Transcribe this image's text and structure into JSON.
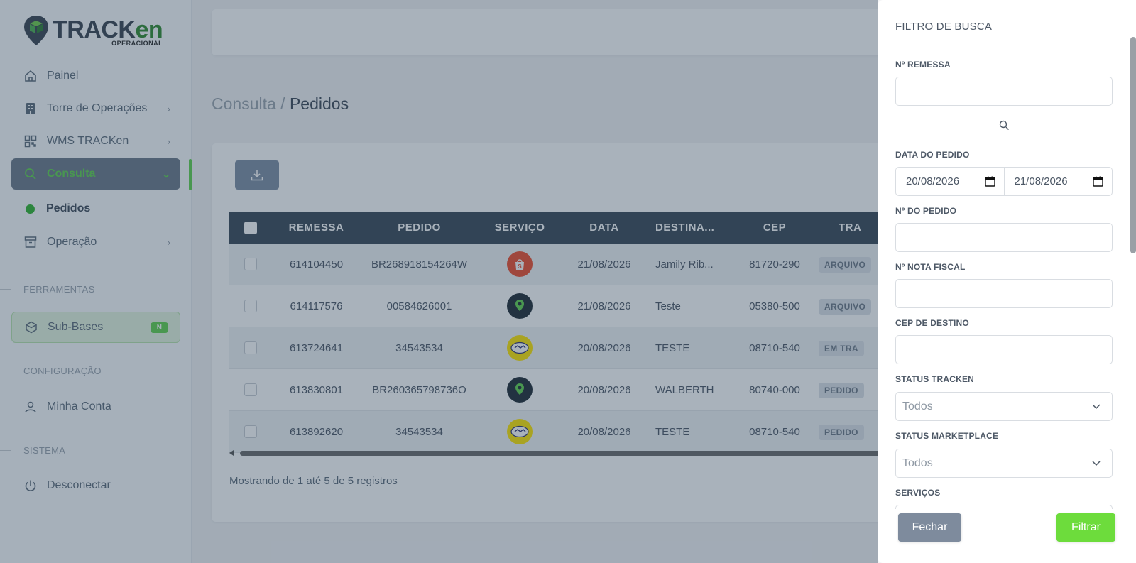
{
  "app": {
    "logo_main": "TRACK",
    "logo_accent": "en",
    "logo_sub": "OPERACIONAL"
  },
  "sidebar": {
    "items": [
      {
        "label": "Painel",
        "icon": "home-icon"
      },
      {
        "label": "Torre de Operações",
        "icon": "building-icon"
      },
      {
        "label": "WMS TRACKen",
        "icon": "qr-icon"
      },
      {
        "label": "Consulta",
        "icon": "search-icon"
      },
      {
        "label": "Pedidos"
      },
      {
        "label": "Operação",
        "icon": "archive-icon"
      }
    ],
    "section_tools": "FERRAMENTAS",
    "subbases": {
      "label": "Sub-Bases",
      "badge": "N"
    },
    "section_config": "CONFIGURAÇÃO",
    "account": "Minha Conta",
    "section_system": "SISTEMA",
    "logout": "Desconectar"
  },
  "breadcrumb": {
    "parent": "Consulta /",
    "current": "Pedidos"
  },
  "table": {
    "headers": [
      "REMESSA",
      "PEDIDO",
      "SERVIÇO",
      "DATA",
      "DESTINA...",
      "CEP",
      "TRA"
    ],
    "rows": [
      {
        "remessa": "614104450",
        "pedido": "BR268918154264W",
        "servico": "shopee",
        "data": "21/08/2026",
        "destino": "Jamily Rib...",
        "cep": "81720-290",
        "status": "ARQUIVO"
      },
      {
        "remessa": "614117576",
        "pedido": "00584626001",
        "servico": "tracken",
        "data": "21/08/2026",
        "destino": "Teste",
        "cep": "05380-500",
        "status": "ARQUIVO"
      },
      {
        "remessa": "613724641",
        "pedido": "34543534",
        "servico": "mercadolivre",
        "data": "20/08/2026",
        "destino": "TESTE",
        "cep": "08710-540",
        "status": "EM TRA"
      },
      {
        "remessa": "613830801",
        "pedido": "BR260365798736O",
        "servico": "tracken",
        "data": "20/08/2026",
        "destino": "WALBERTH",
        "cep": "80740-000",
        "status": "PEDIDO"
      },
      {
        "remessa": "613892620",
        "pedido": "34543534",
        "servico": "mercadolivre",
        "data": "20/08/2026",
        "destino": "TESTE",
        "cep": "08710-540",
        "status": "PEDIDO"
      }
    ],
    "footer": "Mostrando de 1 até 5 de 5 registros"
  },
  "filter": {
    "title": "FILTRO DE BUSCA",
    "remessa_label": "Nº REMESSA",
    "data_label": "DATA DO PEDIDO",
    "date_from": "20/08/2026",
    "date_to": "21/08/2026",
    "pedido_label": "Nº DO PEDIDO",
    "nota_label": "Nº NOTA FISCAL",
    "cep_label": "CEP DE DESTINO",
    "status_tracken_label": "STATUS TRACKEN",
    "status_tracken_value": "Todos",
    "status_mkt_label": "STATUS MARKETPLACE",
    "status_mkt_value": "Todos",
    "servicos_label": "SERVIÇOS",
    "btn_close": "Fechar",
    "btn_filter": "Filtrar"
  },
  "colors": {
    "accent_green": "#5fd24d",
    "header_dark": "#394857",
    "filter_button": "#6ddc3c"
  }
}
